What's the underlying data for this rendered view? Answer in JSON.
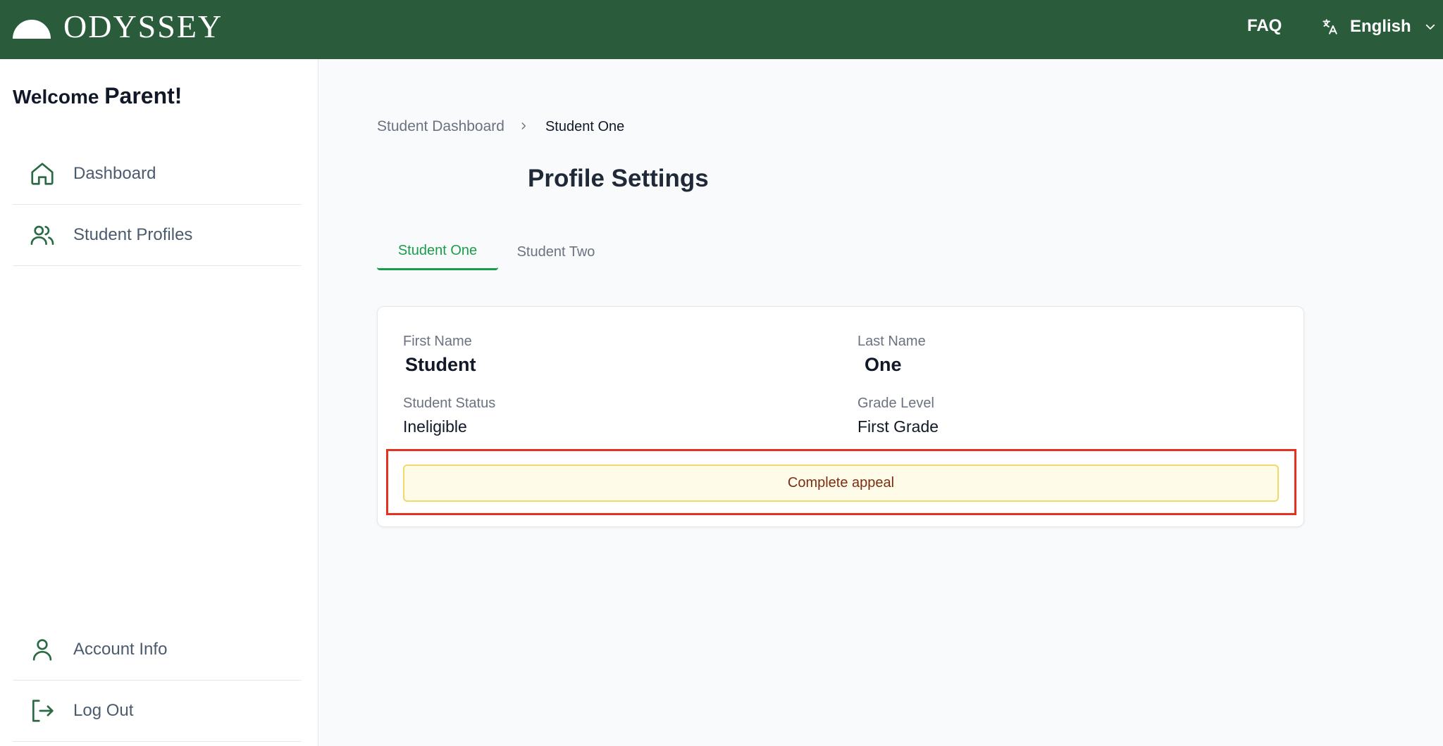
{
  "header": {
    "brand": "ODYSSEY",
    "faq_label": "FAQ",
    "language": "English"
  },
  "sidebar": {
    "welcome_prefix": "Welcome",
    "welcome_name": "Parent!",
    "items": [
      {
        "label": "Dashboard",
        "icon": "home-icon"
      },
      {
        "label": "Student Profiles",
        "icon": "users-icon"
      },
      {
        "label": "Account Info",
        "icon": "user-icon"
      },
      {
        "label": "Log Out",
        "icon": "logout-icon"
      }
    ]
  },
  "breadcrumb": {
    "parent": "Student Dashboard",
    "current": "Student One"
  },
  "page": {
    "title": "Profile Settings"
  },
  "tabs": [
    {
      "label": "Student One",
      "active": true
    },
    {
      "label": "Student Two",
      "active": false
    }
  ],
  "profile": {
    "first_name_label": "First Name",
    "first_name": "Student",
    "last_name_label": "Last Name",
    "last_name": "One",
    "status_label": "Student Status",
    "status": "Ineligible",
    "grade_label": "Grade Level",
    "grade": "First Grade"
  },
  "actions": {
    "appeal_label": "Complete appeal"
  },
  "colors": {
    "header_bg": "#2a5c3c",
    "accent_green": "#1a9d4a",
    "appeal_bg": "#fefbe9",
    "appeal_border": "#f2d86b",
    "highlight_border": "#e3321f"
  }
}
